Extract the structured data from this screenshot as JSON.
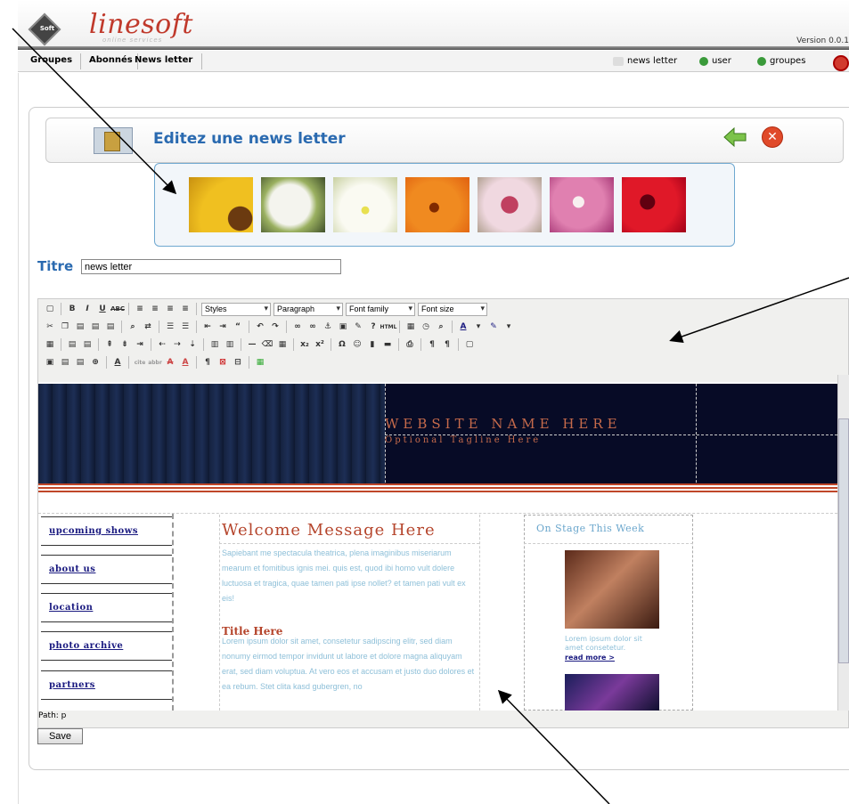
{
  "header": {
    "logo_mark": "Soft",
    "logo_word": "linesoft",
    "logo_sub": "online services",
    "version": "Version 0.0.1"
  },
  "menu": {
    "items": [
      "Groupes",
      "Abonnés",
      "News letter"
    ],
    "right_links": [
      {
        "label": "news letter",
        "icon": "newsletter-icon"
      },
      {
        "label": "user",
        "icon": "user-icon"
      },
      {
        "label": "groupes",
        "icon": "groups-icon"
      }
    ]
  },
  "page": {
    "title": "Editez une news letter",
    "titre_label": "Titre",
    "titre_value": "news letter"
  },
  "toolbar": {
    "styles": "Styles",
    "format": "Paragraph",
    "font_family": "Font family",
    "font_size": "Font size"
  },
  "template": {
    "site_name": "WEBSITE NAME HERE",
    "tagline": "Optional Tagline Here",
    "nav": [
      "upcoming shows",
      "about us",
      "location",
      "photo archive",
      "partners"
    ],
    "welcome": "Welcome Message Here",
    "para1": "Sapiebant me spectacula theatrica, plena imaginibus miseriarum mearum et fomitibus ignis mei. quis est, quod ibi homo vult dolere luctuosa et tragica, quae tamen pati ipse nollet? et tamen pati vult ex eis!",
    "title_here": "Title Here",
    "para2": "Lorem ipsum dolor sit amet, consetetur sadipscing elitr, sed diam nonumy eirmod tempor invidunt ut labore et dolore magna aliquyam erat, sed diam voluptua. At vero eos et accusam et justo duo dolores et ea rebum. Stet clita kasd gubergren, no",
    "onstage_title": "On Stage This Week",
    "lorem_small": "Lorem ipsum dolor sit amet consetetur.",
    "read_more": "read more >"
  },
  "editor": {
    "path": "Path: p",
    "save": "Save"
  },
  "colors": {
    "accent": "#2a6ab0",
    "brand_red": "#c0392b",
    "template_red": "#b5452c"
  }
}
